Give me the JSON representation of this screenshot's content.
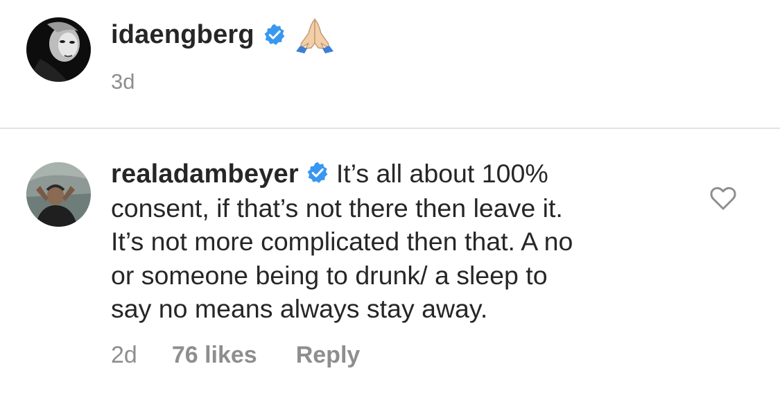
{
  "comments": [
    {
      "username": "idaengberg",
      "verified": true,
      "text": "",
      "emoji": "folded-hands-emoji",
      "time": "3d"
    },
    {
      "username": "realadambeyer",
      "verified": true,
      "text_lines": [
        "It’s all about 100%",
        "consent, if that’s not there then leave it.",
        "It’s not more complicated then that. A no",
        "or someone being to drunk/ a sleep to",
        "say no means always stay away."
      ],
      "time": "2d",
      "likes": "76 likes",
      "reply": "Reply",
      "like_icon": "heart-outline-icon"
    }
  ],
  "colors": {
    "text": "#262626",
    "secondary": "#8e8e8e",
    "verified": "#3897f0",
    "divider": "#e3e3e3"
  }
}
